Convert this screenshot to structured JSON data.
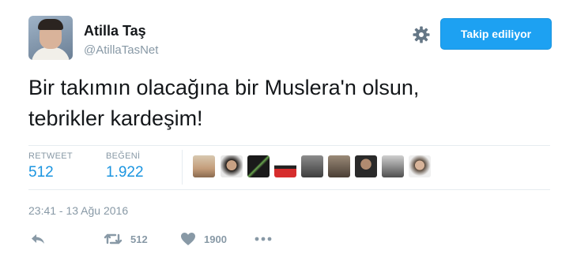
{
  "profile": {
    "name": "Atilla Taş",
    "handle": "@AtillaTasNet"
  },
  "follow_button": {
    "label": "Takip ediliyor"
  },
  "tweet": {
    "text": "Bir takımın olacağına bir Muslera'n olsun,\ntebrikler kardeşim!"
  },
  "stats": {
    "retweets": {
      "label": "RETWEET",
      "value": "512"
    },
    "likes": {
      "label": "BEĞENİ",
      "value": "1.922"
    }
  },
  "timestamp": "23:41 - 13 Ağu 2016",
  "actions": {
    "retweet_count": "512",
    "like_count": "1900"
  },
  "colors": {
    "accent": "#1da1f2",
    "stat_value": "#1b95e0",
    "muted": "#8899a6",
    "divider": "#e6ecf0"
  },
  "icons": {
    "settings": "gear-icon",
    "reply": "reply-icon",
    "retweet": "retweet-icon",
    "like": "heart-icon",
    "more": "more-icon"
  }
}
